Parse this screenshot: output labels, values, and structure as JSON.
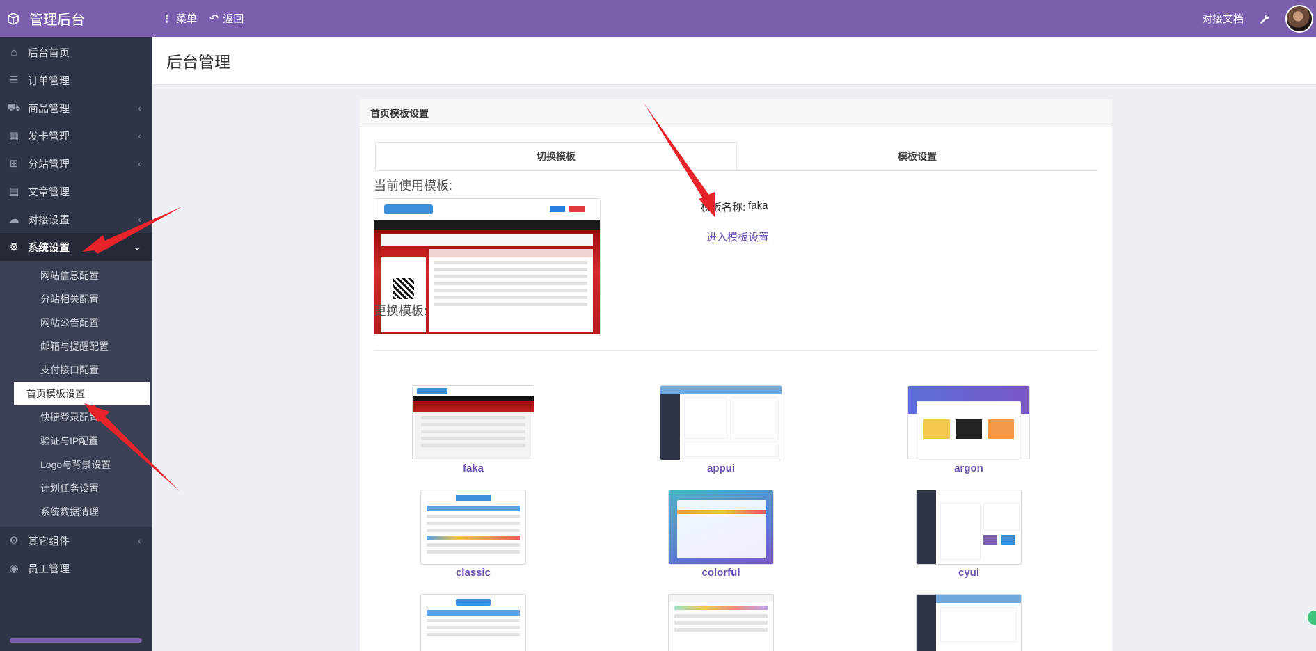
{
  "header": {
    "brand_title": "管理后台",
    "menu_label": "菜单",
    "back_label": "返回",
    "docs_label": "对接文档",
    "brand_color": "#7b5fae"
  },
  "sidebar": {
    "items": [
      {
        "label": "后台首页",
        "icon": "home-icon"
      },
      {
        "label": "订单管理",
        "icon": "list-icon"
      },
      {
        "label": "商品管理",
        "icon": "cart-icon"
      },
      {
        "label": "发卡管理",
        "icon": "grid-icon"
      },
      {
        "label": "分站管理",
        "icon": "sitemap-icon"
      },
      {
        "label": "文章管理",
        "icon": "book-icon"
      },
      {
        "label": "对接设置",
        "icon": "link-icon"
      },
      {
        "label": "系统设置",
        "icon": "gear-icon"
      },
      {
        "label": "其它组件",
        "icon": "cogs-icon"
      },
      {
        "label": "员工管理",
        "icon": "user-icon"
      }
    ],
    "submenu": [
      "网站信息配置",
      "分站相关配置",
      "网站公告配置",
      "邮箱与提醒配置",
      "支付接口配置",
      "首页模板设置",
      "快捷登录配置",
      "验证与IP配置",
      "Logo与背景设置",
      "计划任务设置",
      "系统数据清理"
    ],
    "active_submenu_index": 5
  },
  "page": {
    "title": "后台管理",
    "panel_title": "首页模板设置",
    "tabs": [
      "切换模板",
      "模板设置"
    ],
    "current_label": "当前使用模板:",
    "template_name_label": "模板名称:",
    "template_name_value": "faka",
    "enter_settings_link": "进入模板设置",
    "change_label": "更换模板:",
    "templates": [
      "faka",
      "appui",
      "argon",
      "classic",
      "colorful",
      "cyui"
    ]
  }
}
